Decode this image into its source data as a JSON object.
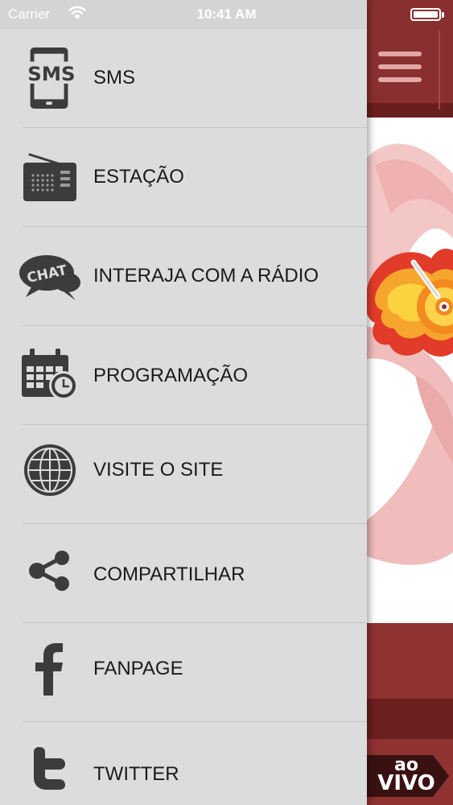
{
  "status_bar": {
    "carrier": "Carrier",
    "time": "10:41 AM",
    "battery_level": 1.0
  },
  "menu": {
    "items": [
      {
        "label": "SMS",
        "icon": "sms-phone-icon"
      },
      {
        "label": "ESTAÇÃO",
        "icon": "radio-icon"
      },
      {
        "label": "INTERAJA COM A RÁDIO",
        "icon": "chat-icon"
      },
      {
        "label": "PROGRAMAÇÃO",
        "icon": "calendar-clock-icon"
      },
      {
        "label": "VISITE O SITE",
        "icon": "globe-icon"
      },
      {
        "label": "COMPARTILHAR",
        "icon": "share-icon"
      },
      {
        "label": "FANPAGE",
        "icon": "facebook-icon"
      },
      {
        "label": "TWITTER",
        "icon": "twitter-icon"
      }
    ],
    "icon_texts": {
      "sms": "SMS",
      "chat": "CHAT"
    }
  },
  "app": {
    "menu_icon": "hamburger-icon",
    "live_button": {
      "line1": "ao",
      "line2": "VIVO"
    }
  },
  "colors": {
    "drawer_bg": "#dcdcdc",
    "icon_gray": "#3c3c3c",
    "brand_red": "#8a2f2f",
    "brand_dark_red": "#6a1f1f",
    "accent_orange": "#f28a1e"
  }
}
